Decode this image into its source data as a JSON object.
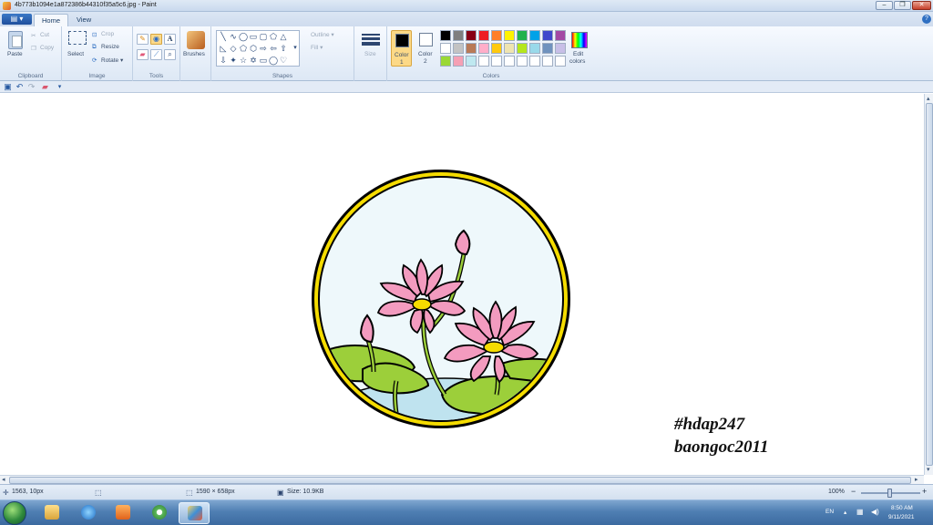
{
  "window": {
    "title": "4b773b1094e1a872386b44310f35a5c6.jpg - Paint",
    "minimize_label": "–",
    "maximize_label": "❐",
    "close_label": "✕"
  },
  "menu_button_label": "▤ ▾",
  "tabs": [
    {
      "label": "Home",
      "active": true
    },
    {
      "label": "View",
      "active": false
    }
  ],
  "help_label": "?",
  "ribbon": {
    "clipboard": {
      "group_label": "Clipboard",
      "paste_label": "Paste",
      "cut_label": "Cut",
      "copy_label": "Copy"
    },
    "image": {
      "group_label": "Image",
      "select_label": "Select",
      "crop_label": "Crop",
      "resize_label": "Resize",
      "rotate_label": "Rotate ▾"
    },
    "tools": {
      "group_label": "Tools",
      "brushes_label": "Brushes"
    },
    "shapes": {
      "group_label": "Shapes",
      "outline_label": "Outline ▾",
      "fill_label": "Fill ▾"
    },
    "size": {
      "label": "Size"
    },
    "colors": {
      "group_label": "Colors",
      "color1_label": "Color",
      "color1_num": "1",
      "color2_label": "Color",
      "color2_num": "2",
      "edit_label_1": "Edit",
      "edit_label_2": "colors",
      "color1": "#000000",
      "color2": "#ffffff",
      "palette": [
        "#000000",
        "#7f7f7f",
        "#880015",
        "#ed1c24",
        "#ff7f27",
        "#fff200",
        "#22b14c",
        "#00a2e8",
        "#3f48cc",
        "#a349a4",
        "#ffffff",
        "#c3c3c3",
        "#b97a57",
        "#ffaec9",
        "#ffc90e",
        "#efe4b0",
        "#b5e61d",
        "#99d9ea",
        "#7092be",
        "#c8bfe7",
        "#9ad835",
        "#f5a0b4",
        "#bfe8f0",
        "#ffffff",
        "#ffffff",
        "#ffffff",
        "#ffffff",
        "#ffffff",
        "#ffffff",
        "#ffffff"
      ]
    }
  },
  "canvas": {
    "hashtag_1": "#hdap247",
    "hashtag_2": "baongoc2011",
    "frame_color": "#f5dc00",
    "sky_color": "#eef8fb",
    "lotus_color": "#f39bbf",
    "leaf_color": "#9ccf3a",
    "water_color": "#bfe3ef"
  },
  "statusbar": {
    "cursor_pos": "1563, 10px",
    "dimensions": "1590 × 658px",
    "file_size": "Size: 10.9KB",
    "zoom": "100%",
    "zoom_minus": "−",
    "zoom_plus": "+"
  },
  "taskbar": {
    "language": "EN",
    "time": "8:50 AM",
    "date": "9/11/2021"
  }
}
